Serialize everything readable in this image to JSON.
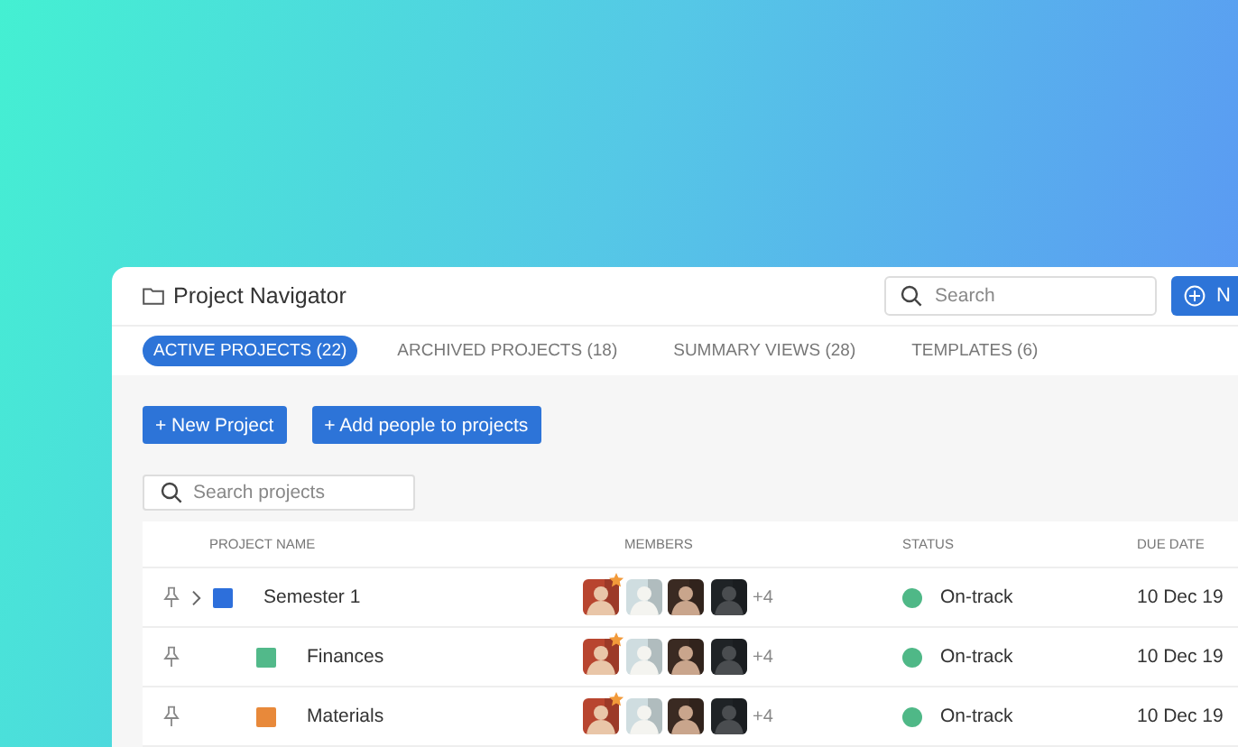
{
  "window": {
    "title": "Project Navigator"
  },
  "search": {
    "placeholder": "Search"
  },
  "new_button": {
    "label": "N"
  },
  "tabs": [
    {
      "label": "ACTIVE PROJECTS (22)",
      "selected": true
    },
    {
      "label": "ARCHIVED PROJECTS (18)",
      "selected": false
    },
    {
      "label": "SUMMARY VIEWS (28)",
      "selected": false
    },
    {
      "label": "TEMPLATES (6)",
      "selected": false
    }
  ],
  "actions": [
    "+ New Project",
    "+ Add people to projects"
  ],
  "project_search": {
    "placeholder": "Search projects"
  },
  "table": {
    "columns": [
      "PROJECT NAME",
      "MEMBERS",
      "STATUS",
      "DUE DATE"
    ],
    "rows": [
      {
        "name": "Semester 1",
        "color": "#2d6fdb",
        "members_extra": "+4",
        "status": "On-track",
        "due": "10 Dec 19",
        "children": [
          {
            "name": "Finances",
            "color": "#52b98a",
            "members_extra": "+4",
            "status": "On-track",
            "due": "10 Dec 19"
          },
          {
            "name": "Materials",
            "color": "#e8893a",
            "members_extra": "+4",
            "status": "On-track",
            "due": "10 Dec 19"
          }
        ]
      }
    ]
  }
}
